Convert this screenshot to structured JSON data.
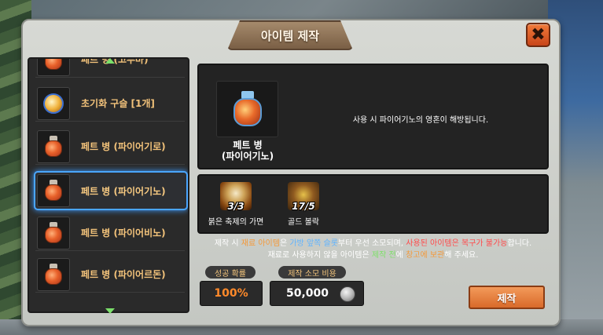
{
  "window": {
    "title": "아이템 제작",
    "close_glyph": "✖"
  },
  "item_list": [
    {
      "label": "페트 병 (고무마)",
      "icon": "potion-icon"
    },
    {
      "label": "초기화 구슬 [1개]",
      "icon": "orb-icon"
    },
    {
      "label": "페트 병 (파이어기로)",
      "icon": "potion-icon"
    },
    {
      "label": "페트 병 (파이어기노)",
      "icon": "potion-icon",
      "selected": true
    },
    {
      "label": "페트 병 (파이어비노)",
      "icon": "potion-icon"
    },
    {
      "label": "페트 병 (파이어르돈)",
      "icon": "potion-icon"
    }
  ],
  "result": {
    "name_line1": "페트 병",
    "name_line2": "(파이어기노)",
    "description": "사용 시 파이어기노의 영혼이 해방됩니다."
  },
  "materials": [
    {
      "name": "붉은 축제의 가면",
      "count": "3/3",
      "icon": "skull-mask-icon"
    },
    {
      "name": "골드 볼락",
      "count": "17/5",
      "icon": "gold-ore-icon"
    }
  ],
  "notice": {
    "l1_a": "제작 시 ",
    "l1_b": "재료 아이템",
    "l1_c": "은 ",
    "l1_d": "가방 앞쪽 슬롯",
    "l1_e": "부터 우선 소모되며, ",
    "l1_f": "사용된 아이템은 복구가 불가능",
    "l1_g": "합니다.",
    "l2_a": "재료로 사용하지 않을 아이템은 ",
    "l2_b": "제작 전",
    "l2_c": "에 ",
    "l2_d": "창고에 보관",
    "l2_e": "해 주세요."
  },
  "stats": {
    "success_label": "성공 확률",
    "success_value": "100%",
    "cost_label": "제작 소모 비용",
    "cost_value": "50,000"
  },
  "craft_button": "제작",
  "colors": {
    "accent_orange": "#f39a3c",
    "accent_blue": "#5fb4ff",
    "accent_red": "#ff4a4a",
    "accent_green": "#7fe06a",
    "selection_glow": "#4aa6ff"
  }
}
